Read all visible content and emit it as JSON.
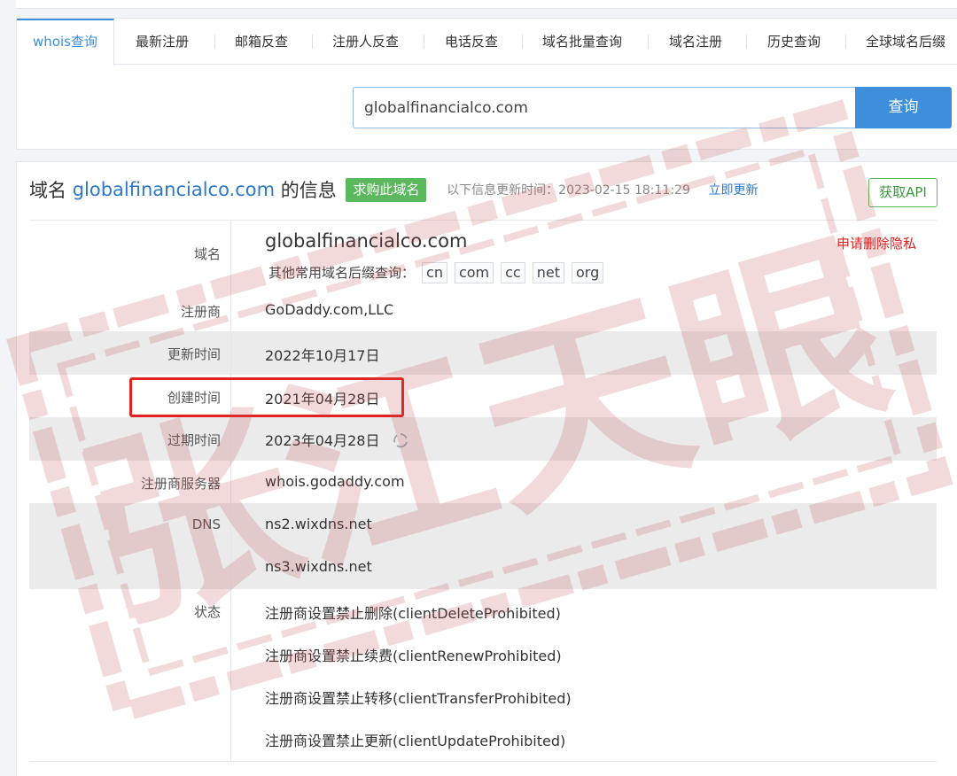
{
  "tabs": [
    "whois查询",
    "最新注册",
    "邮箱反查",
    "注册人反查",
    "电话反查",
    "域名批量查询",
    "域名注册",
    "历史查询",
    "全球域名后缀"
  ],
  "search": {
    "value": "globalfinancialco.com",
    "button": "查询"
  },
  "header": {
    "prefix": "域名",
    "domain": "globalfinancialco.com",
    "suffix": "的信息",
    "buy_badge": "求购此域名",
    "update_note": "以下信息更新时间：2023-02-15 18:11:29",
    "update_link": "立即更新",
    "api_button": "获取API"
  },
  "rows": {
    "domain": {
      "label": "域名",
      "value": "globalfinancialco.com",
      "privacy": "申请删除隐私",
      "suffix_label": "其他常用域名后缀查询：",
      "suffixes": [
        "cn",
        "com",
        "cc",
        "net",
        "org"
      ]
    },
    "registrar": {
      "label": "注册商",
      "value": "GoDaddy.com,LLC"
    },
    "updated": {
      "label": "更新时间",
      "value": "2022年10月17日"
    },
    "created": {
      "label": "创建时间",
      "value": "2021年04月28日"
    },
    "expires": {
      "label": "过期时间",
      "value": "2023年04月28日"
    },
    "registrar_server": {
      "label": "注册商服务器",
      "value": "whois.godaddy.com"
    },
    "dns": {
      "label": "DNS",
      "values": [
        "ns2.wixdns.net",
        "ns3.wixdns.net"
      ]
    },
    "status": {
      "label": "状态",
      "values": [
        "注册商设置禁止删除(clientDeleteProhibited)",
        "注册商设置禁止续费(clientRenewProhibited)",
        "注册商设置禁止转移(clientTransferProhibited)",
        "注册商设置禁止更新(clientUpdateProhibited)"
      ]
    }
  },
  "watermark": {
    "text": "张江天眼"
  },
  "colors": {
    "accent": "#3d8fdc",
    "link": "#2e78c7",
    "badge_green": "#5cb85c",
    "highlight_red": "#e02222",
    "stamp_red": "#c84a4a"
  },
  "icons": {
    "refresh": "refresh-icon"
  }
}
